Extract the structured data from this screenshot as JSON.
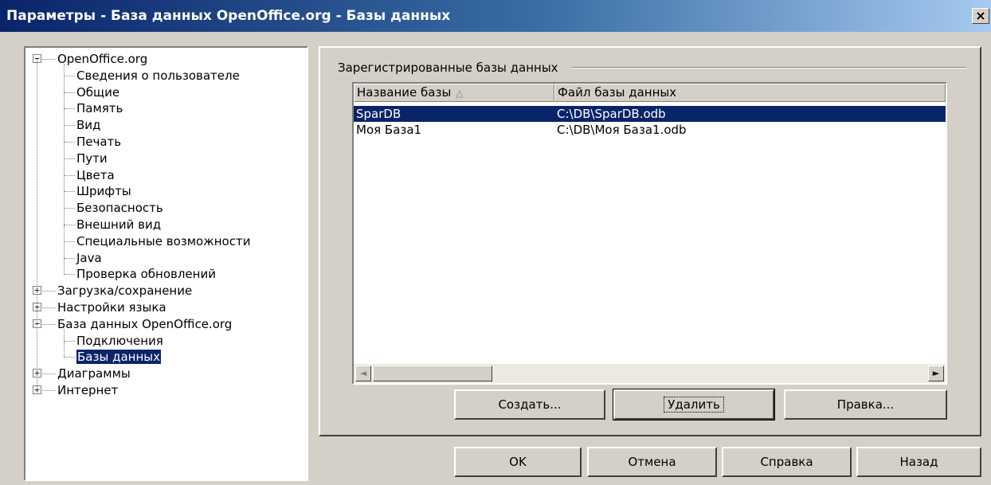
{
  "window": {
    "title": "Параметры - База данных OpenOffice.org - Базы данных",
    "close_glyph": "×"
  },
  "tree": {
    "expander_minus": "−",
    "expander_plus": "+",
    "items": [
      {
        "label": "OpenOffice.org",
        "level": 0,
        "state": "expanded"
      },
      {
        "label": "Сведения о пользователе",
        "level": 1
      },
      {
        "label": "Общие",
        "level": 1
      },
      {
        "label": "Память",
        "level": 1
      },
      {
        "label": "Вид",
        "level": 1
      },
      {
        "label": "Печать",
        "level": 1
      },
      {
        "label": "Пути",
        "level": 1
      },
      {
        "label": "Цвета",
        "level": 1
      },
      {
        "label": "Шрифты",
        "level": 1
      },
      {
        "label": "Безопасность",
        "level": 1
      },
      {
        "label": "Внешний вид",
        "level": 1
      },
      {
        "label": "Специальные возможности",
        "level": 1
      },
      {
        "label": "Java",
        "level": 1
      },
      {
        "label": "Проверка обновлений",
        "level": 1
      },
      {
        "label": "Загрузка/сохранение",
        "level": 0,
        "state": "collapsed"
      },
      {
        "label": "Настройки языка",
        "level": 0,
        "state": "collapsed"
      },
      {
        "label": "База данных OpenOffice.org",
        "level": 0,
        "state": "expanded"
      },
      {
        "label": "Подключения",
        "level": 1
      },
      {
        "label": "Базы данных",
        "level": 1,
        "selected": true
      },
      {
        "label": "Диаграммы",
        "level": 0,
        "state": "collapsed"
      },
      {
        "label": "Интернет",
        "level": 0,
        "state": "collapsed"
      }
    ]
  },
  "registered": {
    "group_title": "Зарегистрированные базы данных",
    "columns": [
      "Название базы",
      "Файл базы данных"
    ],
    "sort_icon": "△",
    "rows": [
      {
        "name": "SparDB",
        "file": "C:\\DB\\SparDB.odb",
        "selected": true
      },
      {
        "name": "Моя База1",
        "file": "C:\\DB\\Моя База1.odb",
        "selected": false
      }
    ],
    "scroll_left": "◄",
    "scroll_right": "►"
  },
  "actions": {
    "create": "Создать...",
    "delete": "Удалить",
    "edit": "Правка..."
  },
  "footer": {
    "ok": "OK",
    "cancel": "Отмена",
    "help": "Справка",
    "back": "Назад"
  },
  "colors": {
    "selection": "#0a246a",
    "face": "#d4d0c8"
  }
}
